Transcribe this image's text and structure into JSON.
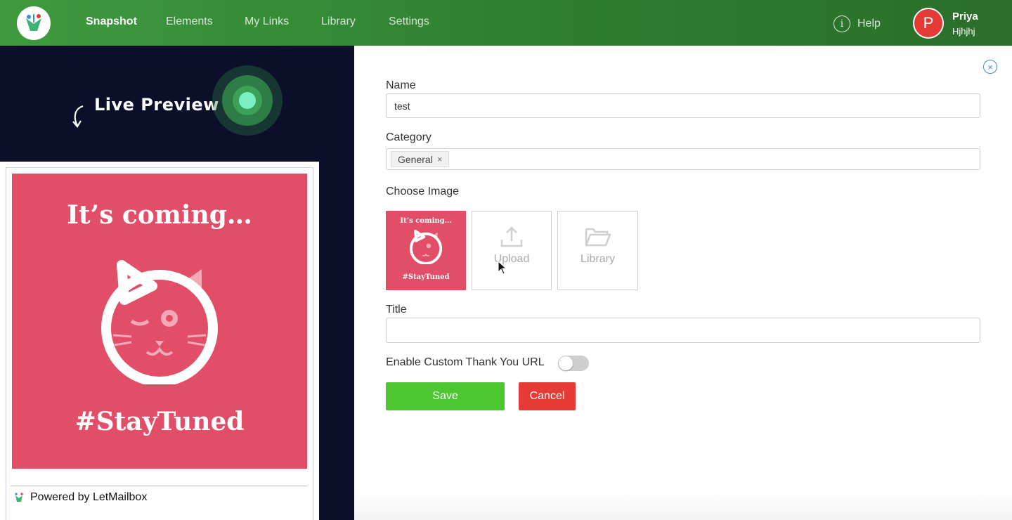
{
  "nav": {
    "items": [
      "Snapshot",
      "Elements",
      "My Links",
      "Library",
      "Settings"
    ],
    "active": "Snapshot",
    "help_label": "Help",
    "help_icon": "i",
    "user": {
      "initial": "P",
      "name": "Priya",
      "subtitle": "Hjhjhj"
    }
  },
  "preview": {
    "heading": "Live Preview",
    "image_top_text": "It’s coming…",
    "image_bottom_text": "#StayTuned",
    "powered_by": "Powered by LetMailbox"
  },
  "form": {
    "name_label": "Name",
    "name_value": "test",
    "category_label": "Category",
    "category_tags": [
      "General"
    ],
    "tag_remove": "×",
    "choose_image_label": "Choose Image",
    "thumb_top_text": "It’s coming…",
    "thumb_bottom_text": "#StayTuned",
    "upload_label": "Upload",
    "library_label": "Library",
    "title_label": "Title",
    "title_value": "",
    "thankyou_label": "Enable Custom Thank You URL",
    "thankyou_enabled": false,
    "save_label": "Save",
    "cancel_label": "Cancel",
    "close_glyph": "×"
  },
  "colors": {
    "nav_green": "#2f7d2f",
    "panel_dark": "#0b0f2a",
    "image_pink": "#e24d68",
    "save_green": "#4cc72f",
    "cancel_red": "#e53a36",
    "avatar_red": "#e53935"
  }
}
